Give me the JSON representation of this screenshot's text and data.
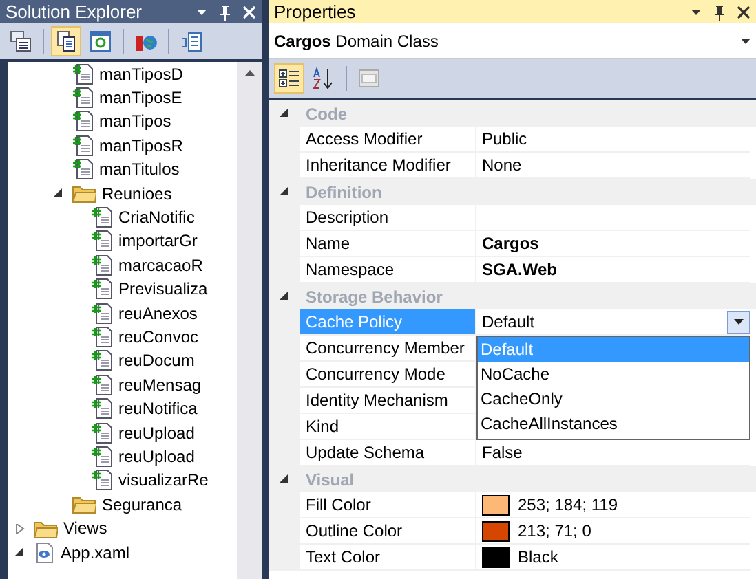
{
  "solution_explorer": {
    "title": "Solution Explorer",
    "active": false,
    "tree": [
      {
        "children": [
          {
            "children": [
              {
                "kind": "file",
                "label": "manTiposD"
              },
              {
                "kind": "file",
                "label": "manTiposE"
              },
              {
                "kind": "file",
                "label": "manTipos"
              },
              {
                "kind": "file",
                "label": "manTiposR"
              },
              {
                "kind": "file",
                "label": "manTitulos"
              },
              {
                "kind": "folder",
                "label": "Reunioes",
                "expanded": true,
                "children": [
                  {
                    "kind": "file",
                    "label": "CriaNotific"
                  },
                  {
                    "kind": "file",
                    "label": "importarGr"
                  },
                  {
                    "kind": "file",
                    "label": "marcacaoR"
                  },
                  {
                    "kind": "file",
                    "label": "Previsualiza"
                  },
                  {
                    "kind": "file",
                    "label": "reuAnexos"
                  },
                  {
                    "kind": "file",
                    "label": "reuConvoc"
                  },
                  {
                    "kind": "file",
                    "label": "reuDocum"
                  },
                  {
                    "kind": "file",
                    "label": "reuMensag"
                  },
                  {
                    "kind": "file",
                    "label": "reuNotifica"
                  },
                  {
                    "kind": "file",
                    "label": "reuUpload"
                  },
                  {
                    "kind": "file",
                    "label": "reuUpload"
                  },
                  {
                    "kind": "file",
                    "label": "visualizarRe"
                  }
                ]
              },
              {
                "kind": "folder",
                "label": "Seguranca"
              }
            ]
          }
        ]
      },
      {
        "kind": "folder",
        "label": "Views",
        "expanded": false
      },
      {
        "kind": "xaml",
        "label": "App.xaml",
        "expanded": true
      }
    ]
  },
  "properties": {
    "title": "Properties",
    "active": true,
    "object": {
      "name": "Cargos",
      "type": "Domain Class"
    },
    "categories": [
      {
        "label": "Code",
        "expanded": true,
        "rows": [
          {
            "name": "Access Modifier",
            "value": "Public",
            "selected": false
          },
          {
            "name": "Inheritance Modifier",
            "value": "None",
            "selected": false
          }
        ]
      },
      {
        "label": "Definition",
        "expanded": true,
        "rows": [
          {
            "name": "Description",
            "selected": false
          },
          {
            "name": "Name",
            "value": "Cargos",
            "bold": true,
            "selected": false
          },
          {
            "name": "Namespace",
            "value": "SGA.Web",
            "bold": true,
            "selected": false
          }
        ]
      },
      {
        "label": "Storage Behavior",
        "expanded": true,
        "rows": [
          {
            "name": "Cache Policy",
            "value": "Default",
            "selected": true,
            "dropdown": {
              "options": [
                {
                  "label": "Default",
                  "selected": true
                },
                {
                  "label": "NoCache",
                  "selected": false
                },
                {
                  "label": "CacheOnly",
                  "selected": false
                },
                {
                  "label": "CacheAllInstances",
                  "selected": false
                }
              ]
            }
          },
          {
            "name": "Concurrency Member",
            "selected": false
          },
          {
            "name": "Concurrency Mode",
            "selected": false
          },
          {
            "name": "Identity Mechanism",
            "selected": false
          },
          {
            "name": "Kind",
            "selected": false
          },
          {
            "name": "Update Schema",
            "value": "False",
            "selected": false
          }
        ]
      },
      {
        "label": "Visual",
        "expanded": true,
        "rows": [
          {
            "name": "Fill Color",
            "value": "253; 184; 119",
            "color": "#fdb877",
            "selected": false
          },
          {
            "name": "Outline Color",
            "value": "213; 71; 0",
            "color": "#d54700",
            "selected": false
          },
          {
            "name": "Text Color",
            "value": "Black",
            "color": "#000000",
            "selected": false
          }
        ]
      }
    ]
  }
}
